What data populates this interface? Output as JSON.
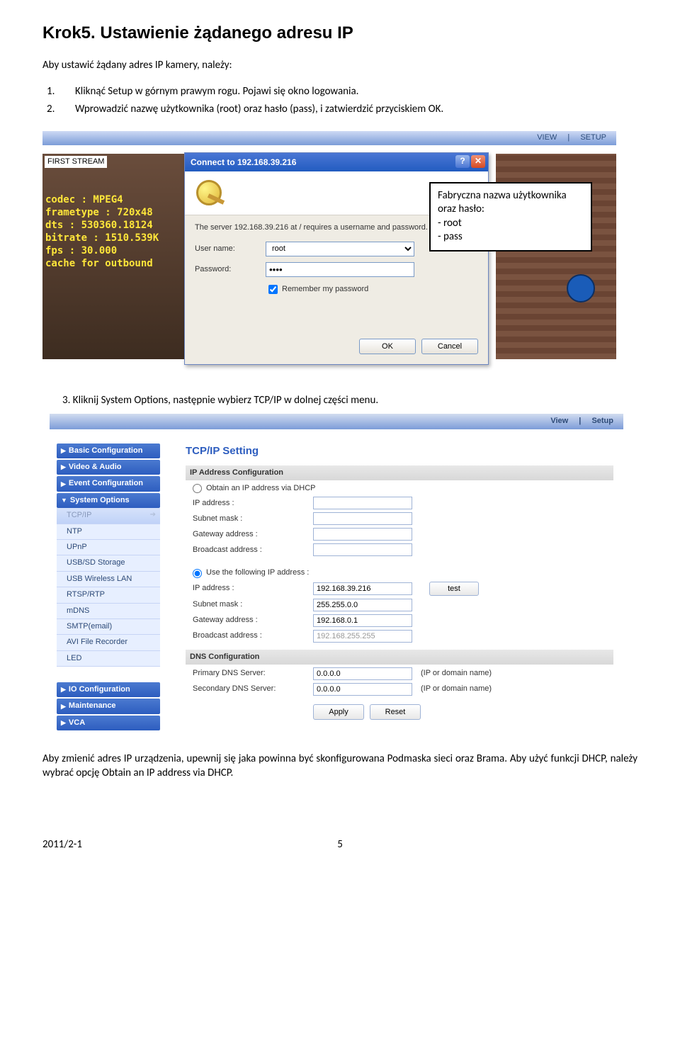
{
  "heading": "Krok5. Ustawienie żądanego adresu IP",
  "intro": "Aby ustawić żądany adres IP kamery, należy:",
  "steps": {
    "s1_num": "1.",
    "s1": "Kliknąć Setup w górnym prawym rogu. Pojawi się okno logowania.",
    "s2_num": "2.",
    "s2": "Wprowadzić nazwę użytkownika (root) oraz hasło (pass), i zatwierdzić przyciskiem OK."
  },
  "shot1": {
    "link_view": "VIEW",
    "link_sep": "|",
    "link_setup": "SETUP",
    "first_stream": "FIRST STREAM",
    "osd": {
      "l1": "codec : MPEG4",
      "l2": "frametype : 720x48",
      "l3": "dts : 530360.18124",
      "l4": "bitrate : 1510.539K",
      "l5": "fps : 30.000",
      "l6": "cache for outbound"
    },
    "dialog": {
      "title": "Connect to 192.168.39.216",
      "help": "?",
      "close": "✕",
      "msg": "The server 192.168.39.216 at / requires a username and password.",
      "user_label": "User name:",
      "user_value": "root",
      "pass_label": "Password:",
      "pass_value": "••••",
      "remember": "Remember my password",
      "ok": "OK",
      "cancel": "Cancel"
    },
    "callout": {
      "l1": "Fabryczna nazwa użytkownika oraz hasło:",
      "l2": "- root",
      "l3": "- pass"
    }
  },
  "step3_num": "3.",
  "step3": "Kliknij System Options, następnie wybierz TCP/IP w dolnej części menu.",
  "shot2": {
    "link_view": "View",
    "link_sep": "|",
    "link_setup": "Setup",
    "menu": {
      "basic": "Basic Configuration",
      "video": "Video & Audio",
      "event": "Event Configuration",
      "system": "System Options",
      "tcpip": "TCP/IP",
      "ntp": "NTP",
      "upnp": "UPnP",
      "usbsd": "USB/SD Storage",
      "usbwlan": "USB Wireless LAN",
      "rtsp": "RTSP/RTP",
      "mdns": "mDNS",
      "smtp": "SMTP(email)",
      "avi": "AVI File Recorder",
      "led": "LED",
      "io": "IO Configuration",
      "maint": "Maintenance",
      "vca": "VCA"
    },
    "title": "TCP/IP Setting",
    "grp1": "IP Address Configuration",
    "opt_dhcp": "Obtain an IP address via DHCP",
    "lbl_ip": "IP address :",
    "lbl_subnet": "Subnet mask :",
    "lbl_gateway": "Gateway address :",
    "lbl_broadcast": "Broadcast address :",
    "opt_static": "Use the following IP address :",
    "val_ip": "192.168.39.216",
    "val_subnet": "255.255.0.0",
    "val_gateway": "192.168.0.1",
    "val_broadcast": "192.168.255.255",
    "btn_test": "test",
    "grp2": "DNS Configuration",
    "lbl_dns1": "Primary DNS Server:",
    "lbl_dns2": "Secondary DNS Server:",
    "val_dns1": "0.0.0.0",
    "val_dns2": "0.0.0.0",
    "hint_dns": "(IP or domain name)",
    "btn_apply": "Apply",
    "btn_reset": "Reset"
  },
  "para": "Aby zmienić adres IP urządzenia, upewnij się jaka powinna być skonfigurowana Podmaska sieci oraz Brama. Aby użyć funkcji DHCP, należy wybrać opcję Obtain an IP address via DHCP.",
  "footer_left": "2011/2-1",
  "footer_page": "5"
}
